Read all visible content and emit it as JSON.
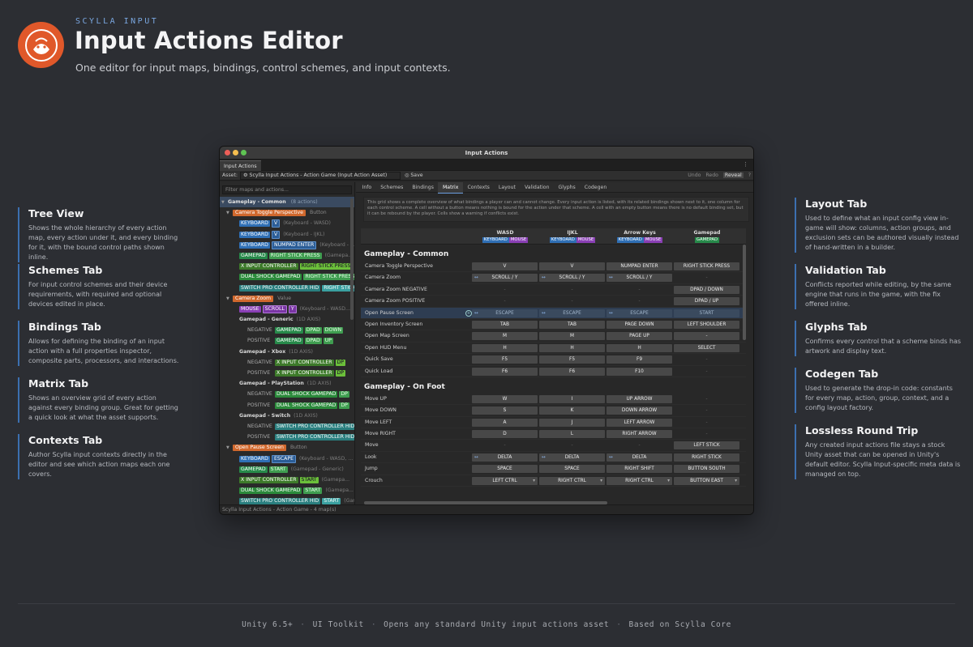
{
  "header": {
    "kicker": "SCYLLA INPUT",
    "title": "Input Actions Editor",
    "subtitle": "One editor for input maps, bindings, control schemes, and input contexts."
  },
  "left_features": [
    {
      "title": "Tree View",
      "desc": "Shows the whole hierarchy of every action map, every action under it, and every binding for it, with the bound control paths shown inline."
    },
    {
      "title": "Schemes Tab",
      "desc": "For input control schemes and their device requirements, with required and optional devices edited in place."
    },
    {
      "title": "Bindings Tab",
      "desc": "Allows for defining the binding of an input action with a full properties inspector, composite parts, processors, and interactions."
    },
    {
      "title": "Matrix Tab",
      "desc": "Shows an overview grid of every action against every binding group. Great for getting a quick look at what the asset supports."
    },
    {
      "title": "Contexts Tab",
      "desc": "Author Scylla input contexts directly in the editor and see which action maps each one covers."
    }
  ],
  "right_features": [
    {
      "title": "Layout Tab",
      "desc": "Used to define what an input config view in-game will show: columns, action groups, and exclusion sets can be authored visually instead of hand-written in a builder."
    },
    {
      "title": "Validation Tab",
      "desc": "Conflicts reported while editing, by the same engine that runs in the game, with the fix offered inline."
    },
    {
      "title": "Glyphs Tab",
      "desc": "Confirms every control that a scheme binds has artwork and display text."
    },
    {
      "title": "Codegen Tab",
      "desc": "Used to generate the drop-in code: constants for every map, action, group, context, and a config layout factory."
    },
    {
      "title": "Lossless Round Trip",
      "desc": "Any created input actions file stays a stock Unity asset that can be opened in Unity's default editor. Scylla Input-specific meta data is managed on top."
    }
  ],
  "footer": [
    "Unity 6.5+",
    "UI Toolkit",
    "Opens any standard Unity input actions asset",
    "Based on Scylla Core"
  ],
  "window": {
    "title": "Input Actions",
    "tab": "Input Actions",
    "asset_label": "Asset:",
    "asset_value": "Scylla Input Actions - Action Game (Input Action Asset)",
    "save": "Save",
    "undo": "Undo",
    "redo": "Redo",
    "reveal": "Reveal",
    "help": "?",
    "status": "Scylla Input Actions - Action Game - 4 map(s)",
    "filter_placeholder": "Filter maps and actions...",
    "tabs": [
      "Info",
      "Schemes",
      "Bindings",
      "Matrix",
      "Contexts",
      "Layout",
      "Validation",
      "Glyphs",
      "Codegen"
    ],
    "info_text": "This grid shows a complete overview of what bindings a player can and cannot change. Every input action is listed, with its related bindings shown next to it, one column for each control scheme. A cell without a button means nothing is bound for the action under that scheme. A cell with an empty button means there is no default binding set, but it can be rebound by the player. Cells show a warning if conflicts exist."
  },
  "tree": {
    "map": "Gameplay - Common",
    "map_meta": "(8 actions)",
    "action1": {
      "name": "Camera Toggle Perspective",
      "type": "Button"
    },
    "b1": [
      {
        "dev": "KEYBOARD",
        "key": "V",
        "path": "(Keyboard - WASD)"
      },
      {
        "dev": "KEYBOARD",
        "key": "V",
        "path": "(Keyboard - IJKL)"
      },
      {
        "dev": "KEYBOARD",
        "key": "NUMPAD ENTER",
        "path": "(Keyboard - ..."
      },
      {
        "dev": "GAMEPAD",
        "key": "RIGHT STICK PRESS",
        "path": "(Gamepa..."
      },
      {
        "dev": "X INPUT CONTROLLER",
        "key": "RIGHT STICK PRESS",
        "path": ""
      },
      {
        "dev": "DUAL SHOCK GAMEPAD",
        "key": "RIGHT STICK PRESS",
        "path": ""
      },
      {
        "dev": "SWITCH PRO CONTROLLER HID",
        "key": "RIGHT STICK",
        "path": ""
      }
    ],
    "action2": {
      "name": "Camera Zoom",
      "type": "Value"
    },
    "mouse": {
      "dev": "MOUSE",
      "key": "SCROLL",
      "key2": "Y",
      "path": "(Keyboard - WASD..."
    },
    "composites": [
      {
        "name": "Gamepad - Generic",
        "meta": "(1D AXIS)",
        "neg": [
          "GAMEPAD",
          "DPAD",
          "DOWN"
        ],
        "pos": [
          "GAMEPAD",
          "DPAD",
          "UP"
        ]
      },
      {
        "name": "Gamepad - Xbox",
        "meta": "(1D AXIS)",
        "neg": [
          "X INPUT CONTROLLER",
          "DP"
        ],
        "pos": [
          "X INPUT CONTROLLER",
          "DP"
        ]
      },
      {
        "name": "Gamepad - PlayStation",
        "meta": "(1D AXIS)",
        "neg": [
          "DUAL SHOCK GAMEPAD",
          "DP"
        ],
        "pos": [
          "DUAL SHOCK GAMEPAD",
          "DP"
        ]
      },
      {
        "name": "Gamepad - Switch",
        "meta": "(1D AXIS)",
        "neg": [
          "SWITCH PRO CONTROLLER HID"
        ],
        "pos": [
          "SWITCH PRO CONTROLLER HID"
        ]
      }
    ],
    "neg_label": "NEGATIVE",
    "pos_label": "POSITIVE",
    "action3": {
      "name": "Open Pause Screen",
      "type": "Button"
    },
    "b3": [
      {
        "dev": "KEYBOARD",
        "key": "ESCAPE",
        "path": "(Keyboard - WASD, ..."
      },
      {
        "dev": "GAMEPAD",
        "key": "START",
        "path": "(Gamepad - Generic)"
      },
      {
        "dev": "X INPUT CONTROLLER",
        "key": "START",
        "path": "(Gamepa..."
      },
      {
        "dev": "DUAL SHOCK GAMEPAD",
        "key": "START",
        "path": "(Gamepa..."
      },
      {
        "dev": "SWITCH PRO CONTROLLER HID",
        "key": "START",
        "path": "(Gam..."
      }
    ]
  },
  "matrix": {
    "columns": [
      {
        "name": "WASD",
        "badges": [
          "KEYBOARD",
          "MOUSE"
        ]
      },
      {
        "name": "IJKL",
        "badges": [
          "KEYBOARD",
          "MOUSE"
        ]
      },
      {
        "name": "Arrow Keys",
        "badges": [
          "KEYBOARD",
          "MOUSE"
        ]
      },
      {
        "name": "Gamepad",
        "badges": [
          "GAMEPAD"
        ]
      }
    ],
    "axis_symbol": "↔",
    "empty": "-",
    "groups": [
      {
        "name": "Gameplay - Common",
        "rows": [
          {
            "action": "Camera Toggle Perspective",
            "cells": [
              "V",
              "V",
              "NUMPAD ENTER",
              "RIGHT STICK PRESS"
            ]
          },
          {
            "action": "Camera Zoom",
            "cells": [
              "SCROLL / Y",
              "SCROLL / Y",
              "SCROLL / Y",
              ""
            ],
            "axis": [
              true,
              true,
              true,
              false
            ]
          },
          {
            "action": "Camera Zoom NEGATIVE",
            "cells": [
              "",
              "",
              "",
              "DPAD / DOWN"
            ]
          },
          {
            "action": "Camera Zoom POSITIVE",
            "cells": [
              "",
              "",
              "",
              "DPAD / UP"
            ]
          },
          {
            "action": "Open Pause Screen",
            "cells": [
              "ESCAPE",
              "ESCAPE",
              "ESCAPE",
              "START"
            ],
            "axis": [
              true,
              true,
              true,
              false
            ],
            "selected": true
          },
          {
            "action": "Open Inventory Screen",
            "cells": [
              "TAB",
              "TAB",
              "PAGE DOWN",
              "LEFT SHOULDER"
            ]
          },
          {
            "action": "Open Map Screen",
            "cells": [
              "M",
              "M",
              "PAGE UP",
              "-"
            ]
          },
          {
            "action": "Open HUD Menu",
            "cells": [
              "H",
              "H",
              "H",
              "SELECT"
            ]
          },
          {
            "action": "Quick Save",
            "cells": [
              "F5",
              "F5",
              "F9",
              ""
            ]
          },
          {
            "action": "Quick Load",
            "cells": [
              "F6",
              "F6",
              "F10",
              ""
            ]
          }
        ]
      },
      {
        "name": "Gameplay - On Foot",
        "rows": [
          {
            "action": "Move UP",
            "cells": [
              "W",
              "I",
              "UP ARROW",
              ""
            ]
          },
          {
            "action": "Move DOWN",
            "cells": [
              "S",
              "K",
              "DOWN ARROW",
              ""
            ]
          },
          {
            "action": "Move LEFT",
            "cells": [
              "A",
              "J",
              "LEFT ARROW",
              ""
            ]
          },
          {
            "action": "Move RIGHT",
            "cells": [
              "D",
              "L",
              "RIGHT ARROW",
              ""
            ]
          },
          {
            "action": "Move",
            "cells": [
              "",
              "",
              "",
              "LEFT STICK"
            ]
          },
          {
            "action": "Look",
            "cells": [
              "DELTA",
              "DELTA",
              "DELTA",
              "RIGHT STICK"
            ],
            "axis": [
              true,
              true,
              true,
              false
            ]
          },
          {
            "action": "Jump",
            "cells": [
              "SPACE",
              "SPACE",
              "RIGHT SHIFT",
              "BUTTON SOUTH"
            ]
          },
          {
            "action": "Crouch",
            "cells": [
              "LEFT CTRL",
              "RIGHT CTRL",
              "RIGHT CTRL",
              "BUTTON EAST"
            ],
            "dropdown": true
          }
        ]
      }
    ]
  }
}
